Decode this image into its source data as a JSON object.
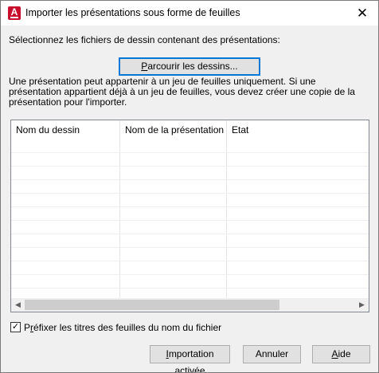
{
  "window": {
    "title": "Importer les présentations sous forme de feuilles",
    "app_icon_letter": "A",
    "close_glyph": "✕"
  },
  "select_label": "Sélectionnez les fichiers de dessin contenant des présentations:",
  "browse": {
    "prefix": "P",
    "rest": "arcourir les dessins..."
  },
  "info_text": "Une présentation peut appartenir à un jeu de feuilles uniquement. Si une présentation appartient déjà à un jeu de feuilles, vous devez créer une copie de la présentation pour l'importer.",
  "table": {
    "columns": [
      "Nom du dessin",
      "Nom de la présentation",
      "Etat"
    ],
    "rows": []
  },
  "checkbox": {
    "checked": true,
    "mark": "✓",
    "prefix": "P",
    "underlined": "r",
    "rest": "éfixer les titres des feuilles du nom du fichier"
  },
  "buttons": {
    "import": {
      "prefix": "I",
      "rest": "mportation activée"
    },
    "cancel": {
      "label": "Annuler"
    },
    "help": {
      "underlined": "A",
      "rest": "ide"
    }
  },
  "scroll": {
    "left_glyph": "◀",
    "right_glyph": "▶"
  },
  "colors": {
    "accent": "#0078d7",
    "app_icon": "#c8102e",
    "button_face": "#e1e1e1"
  }
}
